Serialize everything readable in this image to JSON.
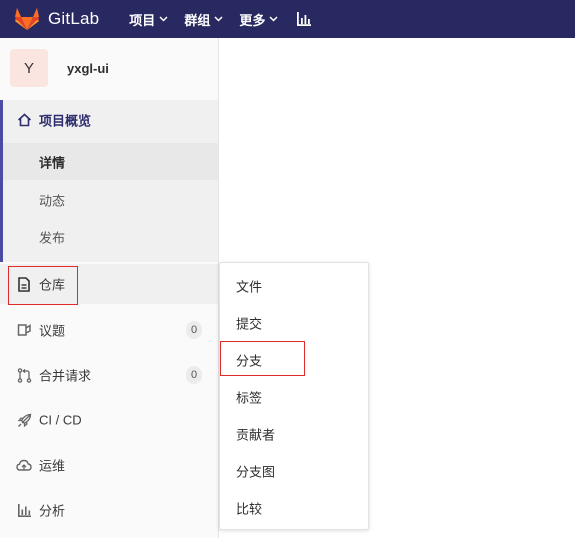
{
  "navbar": {
    "brand": "GitLab",
    "items": [
      {
        "label": "项目"
      },
      {
        "label": "群组"
      },
      {
        "label": "更多"
      }
    ]
  },
  "sidebar": {
    "context": {
      "avatar_letter": "Y",
      "name": "yxgl-ui"
    },
    "overview": {
      "label": "项目概览",
      "sub_items": [
        {
          "label": "详情",
          "active": true
        },
        {
          "label": "动态"
        },
        {
          "label": "发布"
        }
      ]
    },
    "items": [
      {
        "label": "仓库",
        "icon": "doc-icon"
      },
      {
        "label": "议题",
        "icon": "issues-icon",
        "count": "0"
      },
      {
        "label": "合并请求",
        "icon": "merge-request-icon",
        "count": "0"
      },
      {
        "label": "CI / CD",
        "icon": "rocket-icon"
      },
      {
        "label": "运维",
        "icon": "cloud-icon"
      },
      {
        "label": "分析",
        "icon": "analytics-icon"
      }
    ]
  },
  "flyout": {
    "items": [
      {
        "label": "文件"
      },
      {
        "label": "提交"
      },
      {
        "label": "分支"
      },
      {
        "label": "标签"
      },
      {
        "label": "贡献者"
      },
      {
        "label": "分支图"
      },
      {
        "label": "比较"
      }
    ]
  },
  "colors": {
    "navbar_bg": "#292961",
    "active_border": "#4b4ba3",
    "highlight": "#e02b2b"
  }
}
